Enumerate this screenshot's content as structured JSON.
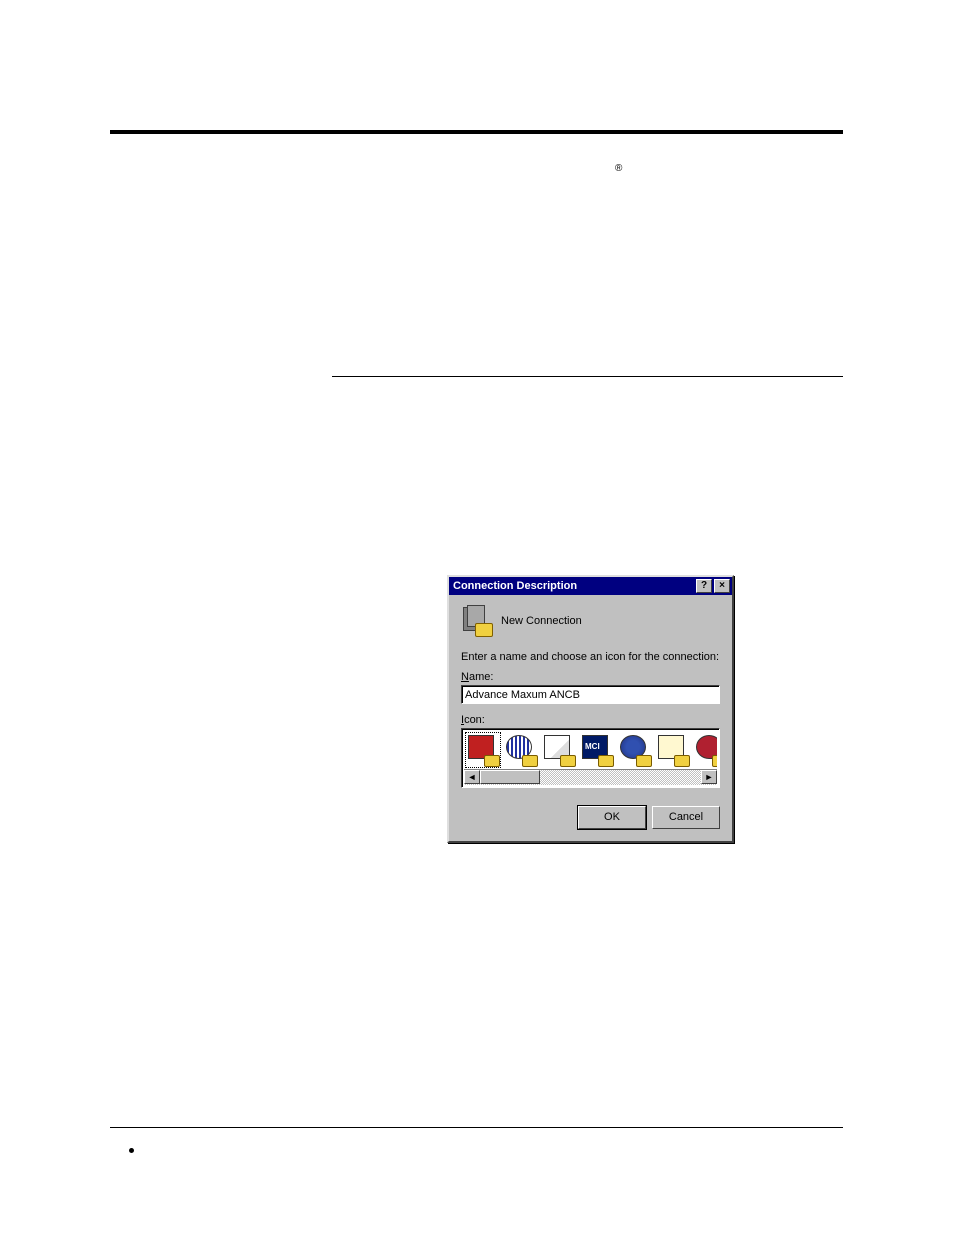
{
  "registered_symbol": "®",
  "dialog": {
    "title": "Connection Description",
    "new_connection": "New Connection",
    "instruction": "Enter a name and choose an icon for the connection:",
    "name_label_pre": "N",
    "name_label_post": "ame:",
    "name_value": "Advance Maxum ANCB",
    "icon_label_pre": "I",
    "icon_label_post": "con:",
    "ok": "OK",
    "cancel": "Cancel",
    "help": "?",
    "close": "×",
    "scroll_left": "◄",
    "scroll_right": "►"
  }
}
